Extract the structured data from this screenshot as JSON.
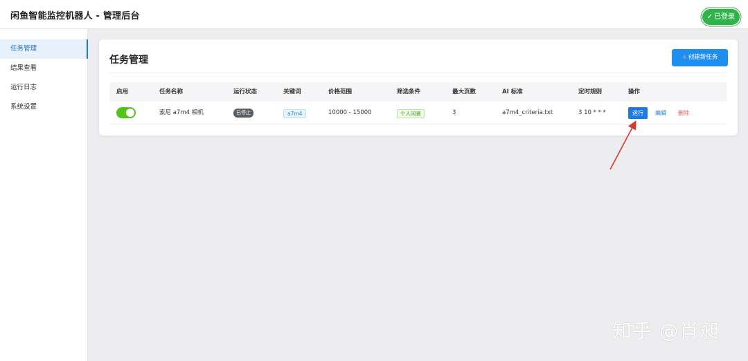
{
  "app": {
    "title": "闲鱼智能监控机器人 - 管理后台",
    "login_status": "已登录"
  },
  "sidebar": {
    "items": [
      {
        "label": "任务管理",
        "active": true
      },
      {
        "label": "结果查看",
        "active": false
      },
      {
        "label": "运行日志",
        "active": false
      },
      {
        "label": "系统设置",
        "active": false
      }
    ]
  },
  "main": {
    "title": "任务管理",
    "create_button": "创建新任务",
    "table": {
      "headers": [
        "启用",
        "任务名称",
        "运行状态",
        "关键词",
        "价格范围",
        "筛选条件",
        "最大页数",
        "AI 标准",
        "定时规则",
        "操作"
      ],
      "rows": [
        {
          "enabled": true,
          "name": "索尼 a7m4 相机",
          "status": "已停止",
          "keyword": "a7m4",
          "price_range": "10000 - 15000",
          "filter": "个人闲置",
          "max_pages": "3",
          "ai_criteria": "a7m4_criteria.txt",
          "schedule": "3 10 * * *",
          "actions": {
            "run": "运行",
            "edit": "编辑",
            "delete": "删除"
          }
        }
      ]
    }
  },
  "watermark": "知乎 @肖昶",
  "colors": {
    "primary": "#1e8fef",
    "success": "#2fb34a",
    "danger": "#e8545a",
    "toggle_on": "#52c41a"
  },
  "icons": {
    "check": "check-icon",
    "plus": "plus-icon"
  }
}
